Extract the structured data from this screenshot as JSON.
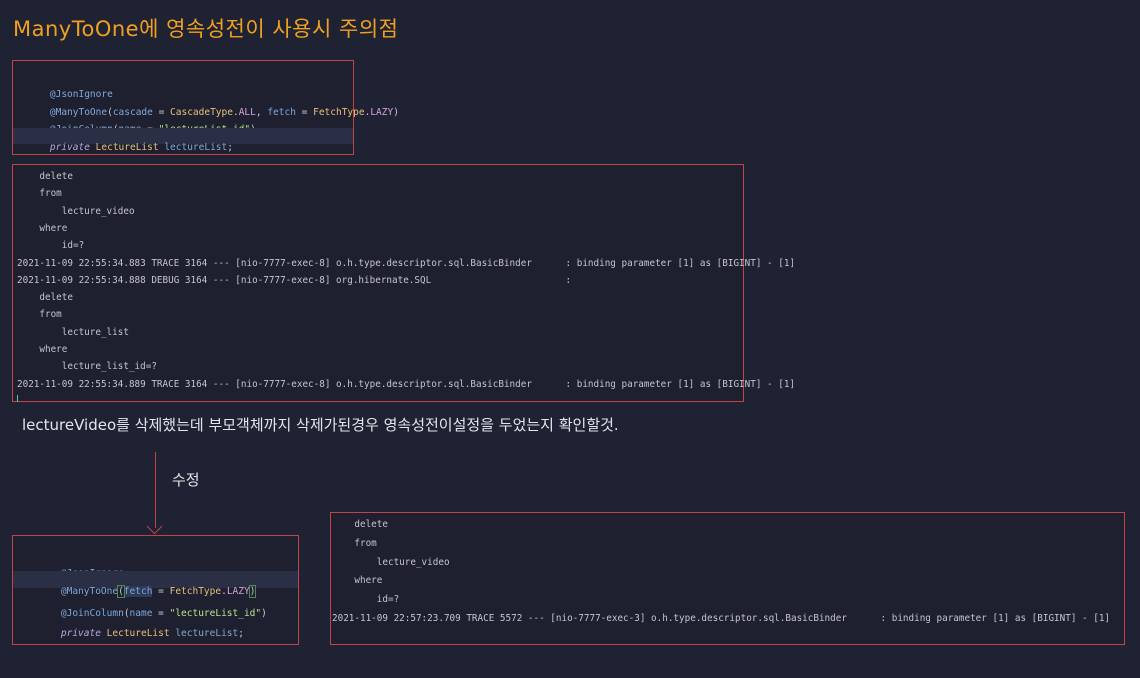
{
  "title": "ManyToOne에 영속성전이 사용시 주의점",
  "code_before": [
    {
      "annotation": "@JsonIgnore"
    },
    {
      "annotation": "@ManyToOne",
      "open": "(",
      "p1": "cascade",
      "eq1": " = ",
      "c1": "CascadeType",
      "dot1": ".",
      "f1": "ALL",
      "comma": ", ",
      "p2": "fetch",
      "eq2": " = ",
      "c2": "FetchType",
      "dot2": ".",
      "f2": "LAZY",
      "close": ")"
    },
    {
      "annotation": "@JoinColumn",
      "open": "(",
      "p1": "name",
      "eq1": " = ",
      "str": "\"lectureList_id\"",
      "close": ")"
    },
    {
      "keyword": "private",
      "type": "LectureList",
      "name": "lectureList",
      "semi": ";"
    }
  ],
  "log_before": [
    "    delete",
    "    from",
    "        lecture_video",
    "    where",
    "        id=?",
    "2021-11-09 22:55:34.883 TRACE 3164 --- [nio-7777-exec-8] o.h.type.descriptor.sql.BasicBinder      : binding parameter [1] as [BIGINT] - [1]",
    "2021-11-09 22:55:34.888 DEBUG 3164 --- [nio-7777-exec-8] org.hibernate.SQL                        :",
    "    delete",
    "    from",
    "        lecture_list",
    "    where",
    "        lecture_list_id=?",
    "2021-11-09 22:55:34.889 TRACE 3164 --- [nio-7777-exec-8] o.h.type.descriptor.sql.BasicBinder      : binding parameter [1] as [BIGINT] - [1]"
  ],
  "note": "lectureVideo를 삭제했는데 부모객체까지 삭제가된경우 영속성전이설정을 두었는지 확인할것.",
  "fix_label": "수정",
  "code_after": [
    {
      "annotation": "@JsonIgnore"
    },
    {
      "annotation": "@ManyToOne",
      "open": "(",
      "p1": "fetch",
      "eq1": " = ",
      "c1": "FetchType",
      "dot1": ".",
      "f1": "LAZY",
      "close": ")"
    },
    {
      "annotation": "@JoinColumn",
      "open": "(",
      "p1": "name",
      "eq1": " = ",
      "str": "\"lectureList_id\"",
      "close": ")"
    },
    {
      "keyword": "private",
      "type": "LectureList",
      "name": "lectureList",
      "semi": ";"
    }
  ],
  "log_after": [
    "    delete",
    "    from",
    "        lecture_video",
    "    where",
    "        id=?",
    "2021-11-09 22:57:23.709 TRACE 5572 --- [nio-7777-exec-3] o.h.type.descriptor.sql.BasicBinder      : binding parameter [1] as [BIGINT] - [1]"
  ],
  "colors": {
    "background": "#1f2233",
    "title": "#f0a020",
    "box_border": "#c0444c",
    "annotation": "#7fa8d8",
    "class_name": "#e6c07b",
    "string": "#b9e58a"
  }
}
